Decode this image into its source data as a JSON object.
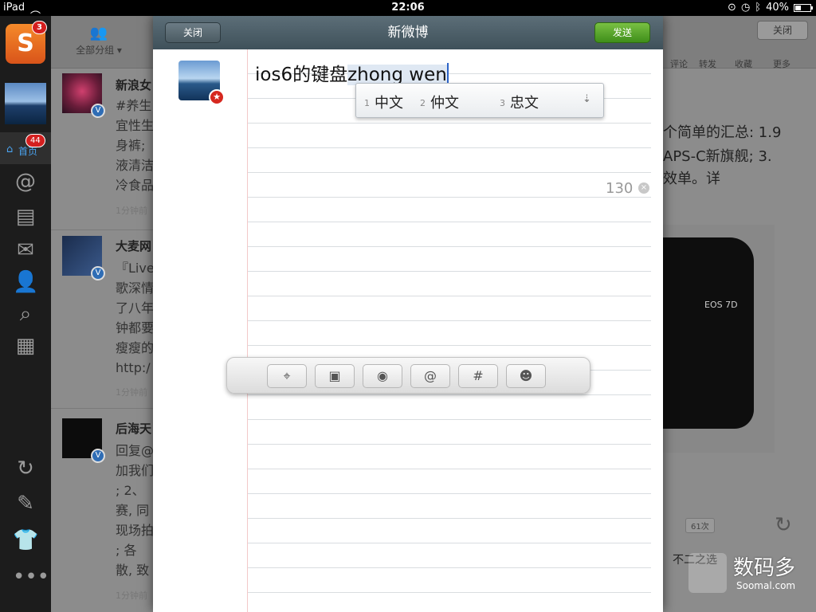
{
  "status_bar": {
    "device": "iPad",
    "time": "22:06",
    "battery": "40%",
    "battery_level": 0.4
  },
  "sidebar": {
    "app_badge": "3",
    "home_label": "首页",
    "home_badge": "44"
  },
  "timeline": {
    "group_label": "全部分组 ▾",
    "close_label": "关闭",
    "posts": [
      {
        "name": "新浪女",
        "lines": [
          "#养生",
          "宜性生",
          "身裤;",
          "液清洁",
          "冷食品"
        ],
        "time": "1分钟前"
      },
      {
        "name": "大麦网",
        "lines": [
          "『Live",
          "歌深情",
          "了八年",
          "钟都要",
          "瘦瘦的",
          "http:/"
        ],
        "time": "1分钟前"
      },
      {
        "name": "后海天",
        "lines": [
          "回复@",
          "加我们",
          ";  2、",
          "赛, 同",
          "现场拍",
          ";  各",
          "散, 致"
        ],
        "time": "1分钟前"
      }
    ],
    "right_tools": [
      "评论",
      "转发",
      "收藏",
      "更多"
    ],
    "right_text": [
      "个简单的汇总: 1.9",
      "APS-C新旗舰; 3.",
      "效单。详"
    ],
    "camera_model": "EOS 7D",
    "repost_count": "61次",
    "right_bottom": "不二之选"
  },
  "compose": {
    "title": "新微博",
    "close_label": "关闭",
    "send_label": "发送",
    "text_committed": "ios6的键盘",
    "text_marked": "zhong wen",
    "candidates": [
      {
        "num": "1",
        "text": "中文"
      },
      {
        "num": "2",
        "text": "仲文"
      },
      {
        "num": "3",
        "text": "忠文"
      }
    ],
    "char_remaining": "130",
    "toolbar_icons": [
      "location-icon",
      "image-icon",
      "camera-icon",
      "mention-icon",
      "topic-icon",
      "emoji-icon"
    ],
    "mention_glyph": "@",
    "topic_glyph": "#"
  },
  "watermark": {
    "cn": "数码多",
    "en": "Soomal.com"
  }
}
